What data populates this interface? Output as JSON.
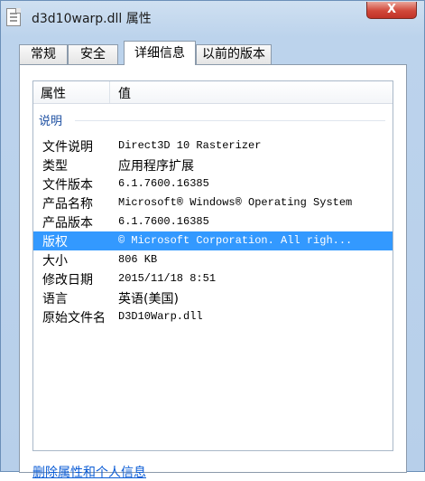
{
  "window": {
    "title": "d3d10warp.dll 属性",
    "close_glyph": "X"
  },
  "tabs": [
    {
      "label": "常规"
    },
    {
      "label": "安全"
    },
    {
      "label": "详细信息"
    },
    {
      "label": "以前的版本"
    }
  ],
  "details": {
    "columns": {
      "property": "属性",
      "value": "值"
    },
    "group": "说明",
    "rows": [
      {
        "label": "文件说明",
        "value": "Direct3D 10 Rasterizer"
      },
      {
        "label": "类型",
        "value": "应用程序扩展"
      },
      {
        "label": "文件版本",
        "value": "6.1.7600.16385"
      },
      {
        "label": "产品名称",
        "value": "Microsoft® Windows® Operating System"
      },
      {
        "label": "产品版本",
        "value": "6.1.7600.16385"
      },
      {
        "label": "版权",
        "value": "© Microsoft Corporation. All righ..."
      },
      {
        "label": "大小",
        "value": "806 KB"
      },
      {
        "label": "修改日期",
        "value": "2015/11/18 8:51"
      },
      {
        "label": "语言",
        "value": "英语(美国)"
      },
      {
        "label": "原始文件名",
        "value": "D3D10Warp.dll"
      }
    ]
  },
  "remove_link": "删除属性和个人信息",
  "colors": {
    "selection": "#3399ff",
    "link": "#0b5cd5",
    "group": "#1e50a2"
  }
}
